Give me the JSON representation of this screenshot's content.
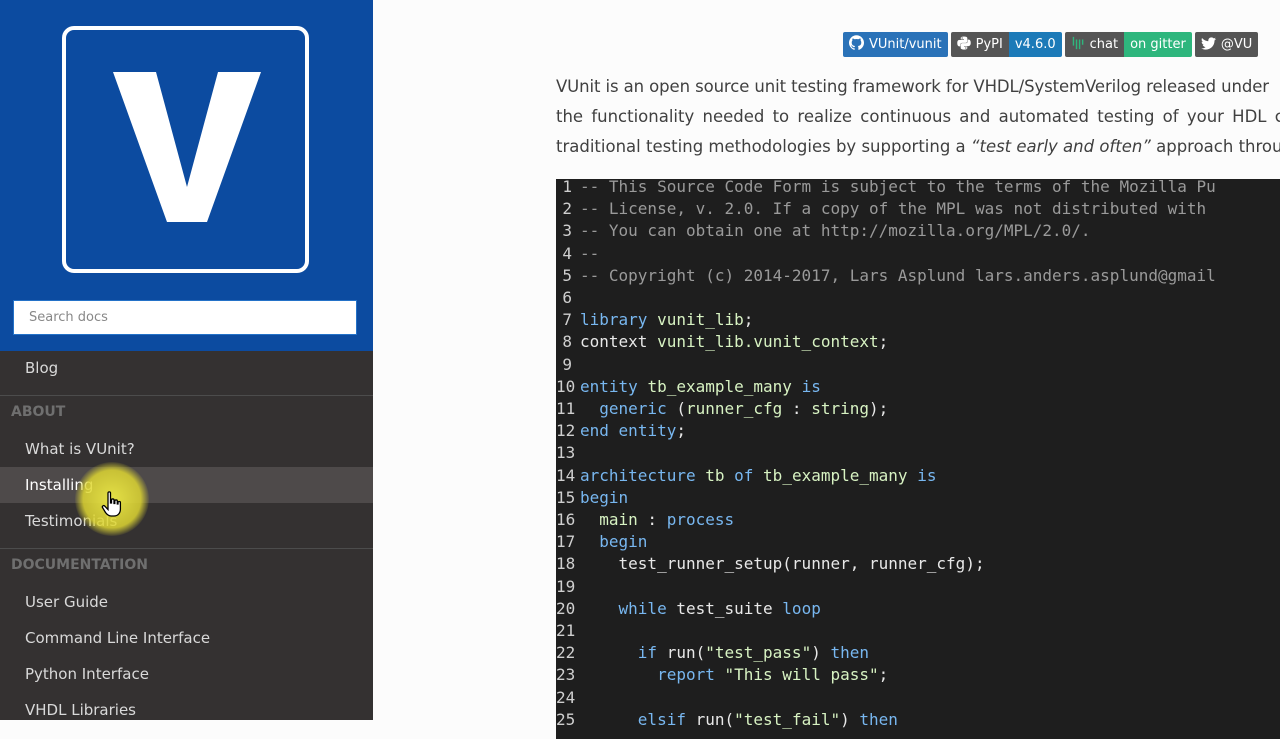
{
  "sidebar": {
    "logo_letter": "V",
    "search_placeholder": "Search docs",
    "items": [
      {
        "label": "Blog"
      },
      {
        "label": "What is VUnit?"
      },
      {
        "label": "Installing"
      },
      {
        "label": "Testimonials"
      },
      {
        "label": "User Guide"
      },
      {
        "label": "Command Line Interface"
      },
      {
        "label": "Python Interface"
      },
      {
        "label": "VHDL Libraries"
      }
    ],
    "captions": {
      "about": "About",
      "documentation": "Documentation"
    }
  },
  "badges": {
    "github": "VUnit/vunit",
    "pypi_label": "PyPI",
    "pypi_version": "v4.6.0",
    "chat_label": "chat",
    "chat_value": "on gitter",
    "twitter": "@VU"
  },
  "intro": {
    "line1": "VUnit is an open source unit testing framework for VHDL/SystemVerilog released under",
    "line2": "the functionality needed to realize continuous and automated testing of your HDL co",
    "line3_pre": "traditional testing methodologies by supporting a ",
    "line3_em": "“test early and often”",
    "line3_post": " approach through"
  },
  "code": {
    "lines": [
      {
        "n": "1",
        "parts": [
          [
            "c",
            "-- This Source Code Form is subject to the terms of the Mozilla Pu"
          ]
        ]
      },
      {
        "n": "2",
        "parts": [
          [
            "c",
            "-- License, v. 2.0. If a copy of the MPL was not distributed with"
          ]
        ]
      },
      {
        "n": "3",
        "parts": [
          [
            "c",
            "-- You can obtain one at http://mozilla.org/MPL/2.0/."
          ]
        ]
      },
      {
        "n": "4",
        "parts": [
          [
            "c",
            "--"
          ]
        ]
      },
      {
        "n": "5",
        "parts": [
          [
            "c",
            "-- Copyright (c) 2014-2017, Lars Asplund lars.anders.asplund@gmail"
          ]
        ]
      },
      {
        "n": "6",
        "parts": []
      },
      {
        "n": "7",
        "parts": [
          [
            "k",
            "library"
          ],
          [
            "p",
            " "
          ],
          [
            "n",
            "vunit_lib"
          ],
          [
            "p",
            ";"
          ]
        ]
      },
      {
        "n": "8",
        "parts": [
          [
            "p",
            "context "
          ],
          [
            "n",
            "vunit_lib.vunit_context"
          ],
          [
            "p",
            ";"
          ]
        ]
      },
      {
        "n": "9",
        "parts": []
      },
      {
        "n": "10",
        "parts": [
          [
            "k",
            "entity"
          ],
          [
            "p",
            " "
          ],
          [
            "n",
            "tb_example_many"
          ],
          [
            "p",
            " "
          ],
          [
            "k",
            "is"
          ]
        ]
      },
      {
        "n": "11",
        "parts": [
          [
            "p",
            "  "
          ],
          [
            "k",
            "generic"
          ],
          [
            "p",
            " ("
          ],
          [
            "n",
            "runner_cfg"
          ],
          [
            "p",
            " : "
          ],
          [
            "t",
            "string"
          ],
          [
            "p",
            ");"
          ]
        ]
      },
      {
        "n": "12",
        "parts": [
          [
            "k",
            "end"
          ],
          [
            "p",
            " "
          ],
          [
            "k",
            "entity"
          ],
          [
            "p",
            ";"
          ]
        ]
      },
      {
        "n": "13",
        "parts": []
      },
      {
        "n": "14",
        "parts": [
          [
            "k",
            "architecture"
          ],
          [
            "p",
            " "
          ],
          [
            "n",
            "tb"
          ],
          [
            "p",
            " "
          ],
          [
            "k",
            "of"
          ],
          [
            "p",
            " "
          ],
          [
            "n",
            "tb_example_many"
          ],
          [
            "p",
            " "
          ],
          [
            "k",
            "is"
          ]
        ]
      },
      {
        "n": "15",
        "parts": [
          [
            "k",
            "begin"
          ]
        ]
      },
      {
        "n": "16",
        "parts": [
          [
            "p",
            "  "
          ],
          [
            "n",
            "main"
          ],
          [
            "p",
            " : "
          ],
          [
            "k",
            "process"
          ]
        ]
      },
      {
        "n": "17",
        "parts": [
          [
            "p",
            "  "
          ],
          [
            "k",
            "begin"
          ]
        ]
      },
      {
        "n": "18",
        "parts": [
          [
            "p",
            "    test_runner_setup(runner, runner_cfg);"
          ]
        ]
      },
      {
        "n": "19",
        "parts": []
      },
      {
        "n": "20",
        "parts": [
          [
            "p",
            "    "
          ],
          [
            "k",
            "while"
          ],
          [
            "p",
            " test_suite "
          ],
          [
            "k",
            "loop"
          ]
        ]
      },
      {
        "n": "21",
        "parts": []
      },
      {
        "n": "22",
        "parts": [
          [
            "p",
            "      "
          ],
          [
            "k",
            "if"
          ],
          [
            "p",
            " run("
          ],
          [
            "t",
            "\"test_pass\""
          ],
          [
            "p",
            ") "
          ],
          [
            "k",
            "then"
          ]
        ]
      },
      {
        "n": "23",
        "parts": [
          [
            "p",
            "        "
          ],
          [
            "k",
            "report"
          ],
          [
            "p",
            " "
          ],
          [
            "t",
            "\"This will pass\""
          ],
          [
            "p",
            ";"
          ]
        ]
      },
      {
        "n": "24",
        "parts": []
      },
      {
        "n": "25",
        "parts": [
          [
            "p",
            "      "
          ],
          [
            "k",
            "elsif"
          ],
          [
            "p",
            " run("
          ],
          [
            "t",
            "\"test_fail\""
          ],
          [
            "p",
            ") "
          ],
          [
            "k",
            "then"
          ]
        ]
      }
    ]
  },
  "colors": {
    "sidebar_bg": "#343131",
    "sidebar_top": "#0c4ba0",
    "code_bg": "#1e1e1e",
    "keyword": "#78b7f0"
  }
}
